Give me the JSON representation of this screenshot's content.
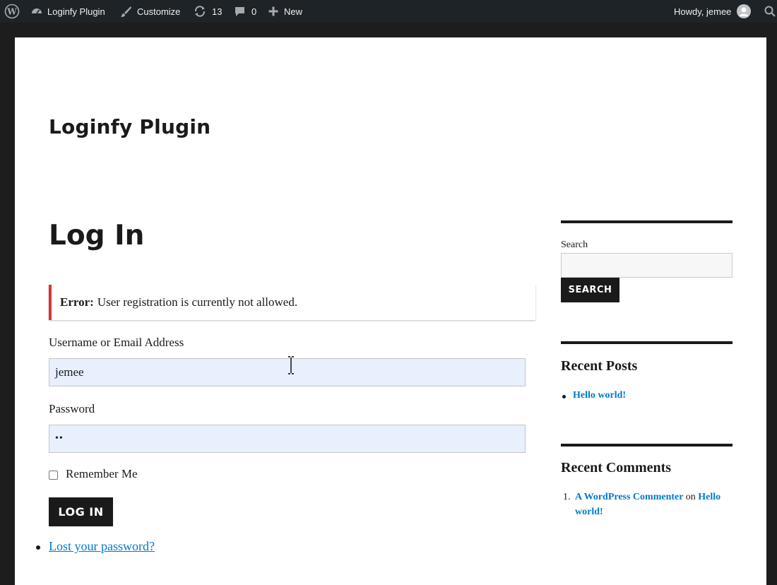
{
  "adminbar": {
    "site_name": "Loginfy Plugin",
    "customize": "Customize",
    "updates_count": "13",
    "comments_count": "0",
    "new_label": "New",
    "howdy": "Howdy, jemee",
    "icons": [
      "wordpress-logo-icon",
      "dashboard-icon",
      "brush-icon",
      "updates-icon",
      "comment-icon",
      "plus-icon",
      "avatar",
      "search-icon"
    ]
  },
  "site": {
    "title": "Loginfy Plugin"
  },
  "login": {
    "heading": "Log In",
    "error_strong": "Error:",
    "error_message": "User registration is currently not allowed.",
    "username_label": "Username or Email Address",
    "username_value": "jemee",
    "password_label": "Password",
    "password_value": "••",
    "remember_label": "Remember Me",
    "submit_label": "LOG IN",
    "lost_password": "Lost your password?"
  },
  "sidebar": {
    "search_label": "Search",
    "search_button": "SEARCH",
    "recent_posts_title": "Recent Posts",
    "recent_posts": [
      "Hello world!"
    ],
    "recent_comments_title": "Recent Comments",
    "comment_number": "1.",
    "comment_author": "A WordPress Commenter",
    "comment_on": "on",
    "comment_post_line1": "Hello",
    "comment_post_line2": "world!"
  },
  "colors": {
    "link": "#007acc",
    "error_accent": "#d63638",
    "adminbar_bg": "#1d2327",
    "autofill_bg": "#e8f0fe"
  }
}
